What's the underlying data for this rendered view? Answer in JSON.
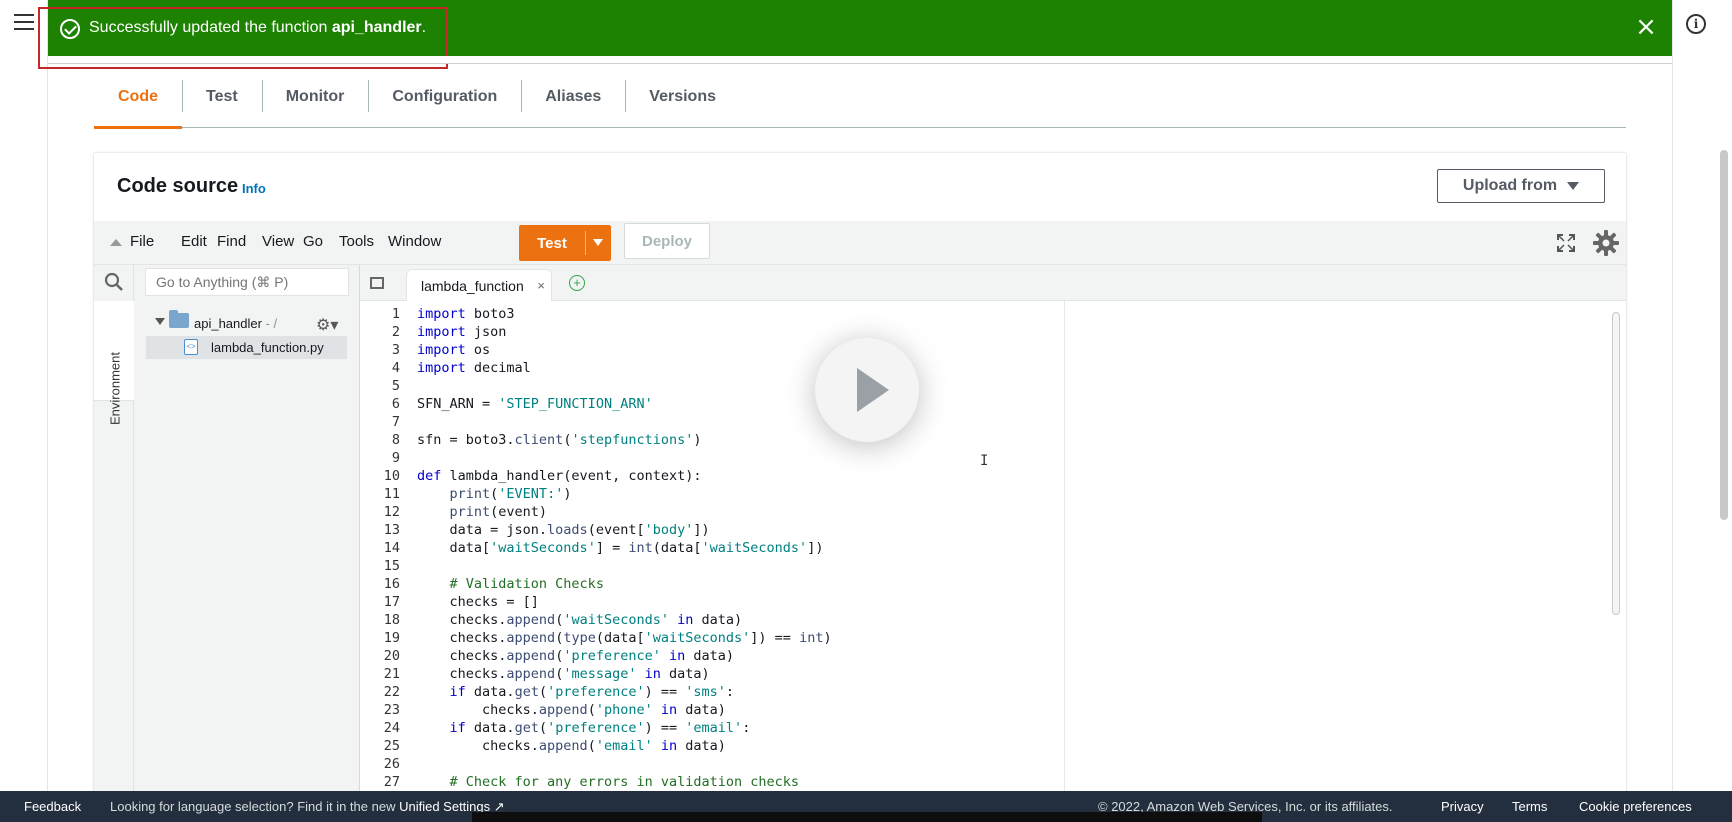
{
  "flash": {
    "message_prefix": "Successfully updated the function ",
    "function_name": "api_handler",
    "message_suffix": "."
  },
  "tabs": [
    "Code",
    "Test",
    "Monitor",
    "Configuration",
    "Aliases",
    "Versions"
  ],
  "active_tab": "Code",
  "code_source": {
    "title": "Code source",
    "info_link": "Info",
    "upload_label": "Upload from"
  },
  "ide": {
    "menu": [
      "File",
      "Edit",
      "Find",
      "View",
      "Go",
      "Tools",
      "Window"
    ],
    "test_label": "Test",
    "deploy_label": "Deploy",
    "goto_placeholder": "Go to Anything (⌘ P)",
    "environment_label": "Environment",
    "folder_name": "api_handler",
    "folder_path": " - /",
    "file_name": "lambda_function.py",
    "editor_tab": "lambda_function"
  },
  "code": [
    [
      [
        "k",
        "import"
      ],
      [
        "t",
        " boto3"
      ]
    ],
    [
      [
        "k",
        "import"
      ],
      [
        "t",
        " json"
      ]
    ],
    [
      [
        "k",
        "import"
      ],
      [
        "t",
        " os"
      ]
    ],
    [
      [
        "k",
        "import"
      ],
      [
        "t",
        " decimal"
      ]
    ],
    [],
    [
      [
        "t",
        "SFN_ARN = "
      ],
      [
        "s",
        "'STEP_FUNCTION_ARN'"
      ]
    ],
    [],
    [
      [
        "t",
        "sfn = boto3."
      ],
      [
        "f",
        "client"
      ],
      [
        "t",
        "("
      ],
      [
        "s",
        "'stepfunctions'"
      ],
      [
        "t",
        ")"
      ]
    ],
    [],
    [
      [
        "k",
        "def"
      ],
      [
        "t",
        " lambda_handler(event, context):"
      ]
    ],
    [
      [
        "t",
        "    "
      ],
      [
        "f",
        "print"
      ],
      [
        "t",
        "("
      ],
      [
        "s",
        "'EVENT:'"
      ],
      [
        "t",
        ")"
      ]
    ],
    [
      [
        "t",
        "    "
      ],
      [
        "f",
        "print"
      ],
      [
        "t",
        "(event)"
      ]
    ],
    [
      [
        "t",
        "    data = json."
      ],
      [
        "f",
        "loads"
      ],
      [
        "t",
        "(event["
      ],
      [
        "s",
        "'body'"
      ],
      [
        "t",
        "])"
      ]
    ],
    [
      [
        "t",
        "    data["
      ],
      [
        "s",
        "'waitSeconds'"
      ],
      [
        "t",
        "] = "
      ],
      [
        "f",
        "int"
      ],
      [
        "t",
        "(data["
      ],
      [
        "s",
        "'waitSeconds'"
      ],
      [
        "t",
        "])"
      ]
    ],
    [],
    [
      [
        "t",
        "    "
      ],
      [
        "c",
        "# Validation Checks"
      ]
    ],
    [
      [
        "t",
        "    checks = []"
      ]
    ],
    [
      [
        "t",
        "    checks."
      ],
      [
        "f",
        "append"
      ],
      [
        "t",
        "("
      ],
      [
        "s",
        "'waitSeconds'"
      ],
      [
        "t",
        " "
      ],
      [
        "k",
        "in"
      ],
      [
        "t",
        " data)"
      ]
    ],
    [
      [
        "t",
        "    checks."
      ],
      [
        "f",
        "append"
      ],
      [
        "t",
        "("
      ],
      [
        "f",
        "type"
      ],
      [
        "t",
        "(data["
      ],
      [
        "s",
        "'waitSeconds'"
      ],
      [
        "t",
        "]) == "
      ],
      [
        "f",
        "int"
      ],
      [
        "t",
        ")"
      ]
    ],
    [
      [
        "t",
        "    checks."
      ],
      [
        "f",
        "append"
      ],
      [
        "t",
        "("
      ],
      [
        "s",
        "'preference'"
      ],
      [
        "t",
        " "
      ],
      [
        "k",
        "in"
      ],
      [
        "t",
        " data)"
      ]
    ],
    [
      [
        "t",
        "    checks."
      ],
      [
        "f",
        "append"
      ],
      [
        "t",
        "("
      ],
      [
        "s",
        "'message'"
      ],
      [
        "t",
        " "
      ],
      [
        "k",
        "in"
      ],
      [
        "t",
        " data)"
      ]
    ],
    [
      [
        "t",
        "    "
      ],
      [
        "k",
        "if"
      ],
      [
        "t",
        " data."
      ],
      [
        "f",
        "get"
      ],
      [
        "t",
        "("
      ],
      [
        "s",
        "'preference'"
      ],
      [
        "t",
        ") == "
      ],
      [
        "s",
        "'sms'"
      ],
      [
        "t",
        ":"
      ]
    ],
    [
      [
        "t",
        "        checks."
      ],
      [
        "f",
        "append"
      ],
      [
        "t",
        "("
      ],
      [
        "s",
        "'phone'"
      ],
      [
        "t",
        " "
      ],
      [
        "k",
        "in"
      ],
      [
        "t",
        " data)"
      ]
    ],
    [
      [
        "t",
        "    "
      ],
      [
        "k",
        "if"
      ],
      [
        "t",
        " data."
      ],
      [
        "f",
        "get"
      ],
      [
        "t",
        "("
      ],
      [
        "s",
        "'preference'"
      ],
      [
        "t",
        ") == "
      ],
      [
        "s",
        "'email'"
      ],
      [
        "t",
        ":"
      ]
    ],
    [
      [
        "t",
        "        checks."
      ],
      [
        "f",
        "append"
      ],
      [
        "t",
        "("
      ],
      [
        "s",
        "'email'"
      ],
      [
        "t",
        " "
      ],
      [
        "k",
        "in"
      ],
      [
        "t",
        " data)"
      ]
    ],
    [],
    [
      [
        "t",
        "    "
      ],
      [
        "c",
        "# Check for any errors in validation checks"
      ]
    ]
  ],
  "footer": {
    "feedback": "Feedback",
    "language_prefix": "Looking for language selection? Find it in the new ",
    "unified_settings": "Unified Settings",
    "copyright": "© 2022, Amazon Web Services, Inc. or its affiliates.",
    "privacy": "Privacy",
    "terms": "Terms",
    "cookies": "Cookie preferences"
  },
  "colors": {
    "success_green": "#1d8102",
    "aws_orange": "#ec7211",
    "keyword": "#0000cc",
    "string": "#008080",
    "comment": "#236e24",
    "function": "#3c4c72"
  }
}
